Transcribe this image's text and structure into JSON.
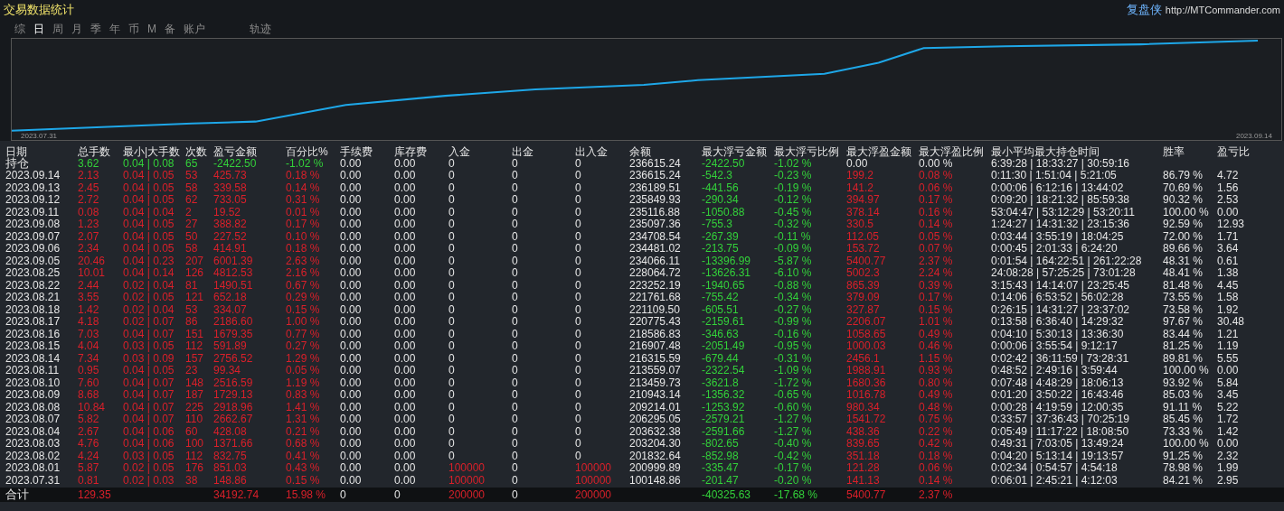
{
  "title": "交易数据统计",
  "brand": {
    "name": "复盘侠",
    "url": "http://MTCommander.com"
  },
  "tabs": [
    {
      "label": "综",
      "selected": false
    },
    {
      "label": "日",
      "selected": true
    },
    {
      "label": "周",
      "selected": false
    },
    {
      "label": "月",
      "selected": false
    },
    {
      "label": "季",
      "selected": false
    },
    {
      "label": "年",
      "selected": false
    },
    {
      "label": "币",
      "selected": false
    },
    {
      "label": "M",
      "selected": false
    },
    {
      "label": "备",
      "selected": false
    },
    {
      "label": "账户",
      "selected": false
    },
    {
      "label": "轨迹",
      "selected": false
    }
  ],
  "chart": {
    "start_label": "2023.07.31",
    "end_label": "2023.09.14"
  },
  "table": {
    "columns": [
      "日期",
      "总手数",
      "最小|大手数",
      "次数",
      "盈亏金额",
      "百分比%",
      "手续费",
      "库存费",
      "入金",
      "出金",
      "出入金",
      "余额",
      "最大浮亏金额",
      "最大浮亏比例",
      "最大浮盈金额",
      "最大浮盈比例",
      "最小平均最大持仓时间",
      "胜率",
      "盈亏比"
    ],
    "rows": [
      {
        "kind": "open",
        "deposit": false,
        "cells": [
          "持仓",
          "3.62",
          "0.04 | 0.08",
          "65",
          "-2422.50",
          "-1.02 %",
          "0.00",
          "0.00",
          "0",
          "0",
          "0",
          "236615.24",
          "-2422.50",
          "-1.02 %",
          "0.00",
          "0.00 %",
          "6:39:28 | 18:33:27 | 30:59:16",
          null,
          null
        ]
      },
      {
        "kind": "day",
        "deposit": false,
        "cells": [
          "2023.09.14",
          "2.13",
          "0.04 | 0.05",
          "53",
          "425.73",
          "0.18 %",
          "0.00",
          "0.00",
          "0",
          "0",
          "0",
          "236615.24",
          "-542.3",
          "-0.23 %",
          "199.2",
          "0.08 %",
          "0:11:30 | 1:51:04 | 5:21:05",
          "86.79 %",
          "4.72"
        ]
      },
      {
        "kind": "day",
        "deposit": false,
        "cells": [
          "2023.09.13",
          "2.45",
          "0.04 | 0.05",
          "58",
          "339.58",
          "0.14 %",
          "0.00",
          "0.00",
          "0",
          "0",
          "0",
          "236189.51",
          "-441.56",
          "-0.19 %",
          "141.2",
          "0.06 %",
          "0:00:06 | 6:12:16 | 13:44:02",
          "70.69 %",
          "1.56"
        ]
      },
      {
        "kind": "day",
        "deposit": false,
        "cells": [
          "2023.09.12",
          "2.72",
          "0.04 | 0.05",
          "62",
          "733.05",
          "0.31 %",
          "0.00",
          "0.00",
          "0",
          "0",
          "0",
          "235849.93",
          "-290.34",
          "-0.12 %",
          "394.97",
          "0.17 %",
          "0:09:20 | 18:21:32 | 85:59:38",
          "90.32 %",
          "2.53"
        ]
      },
      {
        "kind": "day",
        "deposit": false,
        "cells": [
          "2023.09.11",
          "0.08",
          "0.04 | 0.04",
          "2",
          "19.52",
          "0.01 %",
          "0.00",
          "0.00",
          "0",
          "0",
          "0",
          "235116.88",
          "-1050.88",
          "-0.45 %",
          "378.14",
          "0.16 %",
          "53:04:47 | 53:12:29 | 53:20:11",
          "100.00 %",
          "0.00"
        ]
      },
      {
        "kind": "day",
        "deposit": false,
        "cells": [
          "2023.09.08",
          "1.23",
          "0.04 | 0.05",
          "27",
          "388.82",
          "0.17 %",
          "0.00",
          "0.00",
          "0",
          "0",
          "0",
          "235097.36",
          "-755.3",
          "-0.32 %",
          "330.5",
          "0.14 %",
          "1:24:27 | 14:31:32 | 23:15:36",
          "92.59 %",
          "12.93"
        ]
      },
      {
        "kind": "day",
        "deposit": false,
        "cells": [
          "2023.09.07",
          "2.07",
          "0.04 | 0.05",
          "50",
          "227.52",
          "0.10 %",
          "0.00",
          "0.00",
          "0",
          "0",
          "0",
          "234708.54",
          "-267.39",
          "-0.11 %",
          "112.05",
          "0.05 %",
          "0:03:44 | 3:55:19 | 18:04:25",
          "72.00 %",
          "1.71"
        ]
      },
      {
        "kind": "day",
        "deposit": false,
        "cells": [
          "2023.09.06",
          "2.34",
          "0.04 | 0.05",
          "58",
          "414.91",
          "0.18 %",
          "0.00",
          "0.00",
          "0",
          "0",
          "0",
          "234481.02",
          "-213.75",
          "-0.09 %",
          "153.72",
          "0.07 %",
          "0:00:45 | 2:01:33 | 6:24:20",
          "89.66 %",
          "3.64"
        ]
      },
      {
        "kind": "day",
        "deposit": false,
        "cells": [
          "2023.09.05",
          "20.46",
          "0.04 | 0.23",
          "207",
          "6001.39",
          "2.63 %",
          "0.00",
          "0.00",
          "0",
          "0",
          "0",
          "234066.11",
          "-13396.99",
          "-5.87 %",
          "5400.77",
          "2.37 %",
          "0:01:54 | 164:22:51 | 261:22:28",
          "48.31 %",
          "0.61"
        ]
      },
      {
        "kind": "day",
        "deposit": false,
        "cells": [
          "2023.08.25",
          "10.01",
          "0.04 | 0.14",
          "126",
          "4812.53",
          "2.16 %",
          "0.00",
          "0.00",
          "0",
          "0",
          "0",
          "228064.72",
          "-13626.31",
          "-6.10 %",
          "5002.3",
          "2.24 %",
          "24:08:28 | 57:25:25 | 73:01:28",
          "48.41 %",
          "1.38"
        ]
      },
      {
        "kind": "day",
        "deposit": false,
        "cells": [
          "2023.08.22",
          "2.44",
          "0.02 | 0.04",
          "81",
          "1490.51",
          "0.67 %",
          "0.00",
          "0.00",
          "0",
          "0",
          "0",
          "223252.19",
          "-1940.65",
          "-0.88 %",
          "865.39",
          "0.39 %",
          "3:15:43 | 14:14:07 | 23:25:45",
          "81.48 %",
          "4.45"
        ]
      },
      {
        "kind": "day",
        "deposit": false,
        "cells": [
          "2023.08.21",
          "3.55",
          "0.02 | 0.05",
          "121",
          "652.18",
          "0.29 %",
          "0.00",
          "0.00",
          "0",
          "0",
          "0",
          "221761.68",
          "-755.42",
          "-0.34 %",
          "379.09",
          "0.17 %",
          "0:14:06 | 6:53:52 | 56:02:28",
          "73.55 %",
          "1.58"
        ]
      },
      {
        "kind": "day",
        "deposit": false,
        "cells": [
          "2023.08.18",
          "1.42",
          "0.02 | 0.04",
          "53",
          "334.07",
          "0.15 %",
          "0.00",
          "0.00",
          "0",
          "0",
          "0",
          "221109.50",
          "-605.51",
          "-0.27 %",
          "327.87",
          "0.15 %",
          "0:26:15 | 14:31:27 | 23:37:02",
          "73.58 %",
          "1.92"
        ]
      },
      {
        "kind": "day",
        "deposit": false,
        "cells": [
          "2023.08.17",
          "4.18",
          "0.02 | 0.07",
          "86",
          "2186.60",
          "1.00 %",
          "0.00",
          "0.00",
          "0",
          "0",
          "0",
          "220775.43",
          "-2159.61",
          "-0.99 %",
          "2206.07",
          "1.01 %",
          "0:13:58 | 6:36:40 | 14:29:32",
          "97.67 %",
          "30.48"
        ]
      },
      {
        "kind": "day",
        "deposit": false,
        "cells": [
          "2023.08.16",
          "7.03",
          "0.04 | 0.07",
          "151",
          "1679.35",
          "0.77 %",
          "0.00",
          "0.00",
          "0",
          "0",
          "0",
          "218586.83",
          "-346.63",
          "-0.16 %",
          "1058.65",
          "0.49 %",
          "0:04:10 | 5:30:13 | 13:36:30",
          "83.44 %",
          "1.21"
        ]
      },
      {
        "kind": "day",
        "deposit": false,
        "cells": [
          "2023.08.15",
          "4.04",
          "0.03 | 0.05",
          "112",
          "591.89",
          "0.27 %",
          "0.00",
          "0.00",
          "0",
          "0",
          "0",
          "216907.48",
          "-2051.49",
          "-0.95 %",
          "1000.03",
          "0.46 %",
          "0:00:06 | 3:55:54 | 9:12:17",
          "81.25 %",
          "1.19"
        ]
      },
      {
        "kind": "day",
        "deposit": false,
        "cells": [
          "2023.08.14",
          "7.34",
          "0.03 | 0.09",
          "157",
          "2756.52",
          "1.29 %",
          "0.00",
          "0.00",
          "0",
          "0",
          "0",
          "216315.59",
          "-679.44",
          "-0.31 %",
          "2456.1",
          "1.15 %",
          "0:02:42 | 36:11:59 | 73:28:31",
          "89.81 %",
          "5.55"
        ]
      },
      {
        "kind": "day",
        "deposit": false,
        "cells": [
          "2023.08.11",
          "0.95",
          "0.04 | 0.05",
          "23",
          "99.34",
          "0.05 %",
          "0.00",
          "0.00",
          "0",
          "0",
          "0",
          "213559.07",
          "-2322.54",
          "-1.09 %",
          "1988.91",
          "0.93 %",
          "0:48:52 | 2:49:16 | 3:59:44",
          "100.00 %",
          "0.00"
        ]
      },
      {
        "kind": "day",
        "deposit": false,
        "cells": [
          "2023.08.10",
          "7.60",
          "0.04 | 0.07",
          "148",
          "2516.59",
          "1.19 %",
          "0.00",
          "0.00",
          "0",
          "0",
          "0",
          "213459.73",
          "-3621.8",
          "-1.72 %",
          "1680.36",
          "0.80 %",
          "0:07:48 | 4:48:29 | 18:06:13",
          "93.92 %",
          "5.84"
        ]
      },
      {
        "kind": "day",
        "deposit": false,
        "cells": [
          "2023.08.09",
          "8.68",
          "0.04 | 0.07",
          "187",
          "1729.13",
          "0.83 %",
          "0.00",
          "0.00",
          "0",
          "0",
          "0",
          "210943.14",
          "-1356.32",
          "-0.65 %",
          "1016.78",
          "0.49 %",
          "0:01:20 | 3:50:22 | 16:43:46",
          "85.03 %",
          "3.45"
        ]
      },
      {
        "kind": "day",
        "deposit": false,
        "cells": [
          "2023.08.08",
          "10.84",
          "0.04 | 0.07",
          "225",
          "2918.96",
          "1.41 %",
          "0.00",
          "0.00",
          "0",
          "0",
          "0",
          "209214.01",
          "-1253.92",
          "-0.60 %",
          "980.34",
          "0.48 %",
          "0:00:28 | 4:19:59 | 12:00:35",
          "91.11 %",
          "5.22"
        ]
      },
      {
        "kind": "day",
        "deposit": false,
        "cells": [
          "2023.08.07",
          "5.82",
          "0.04 | 0.07",
          "110",
          "2662.67",
          "1.31 %",
          "0.00",
          "0.00",
          "0",
          "0",
          "0",
          "206295.05",
          "-2579.21",
          "-1.27 %",
          "1541.72",
          "0.75 %",
          "0:33:57 | 37:36:43 | 70:25:19",
          "85.45 %",
          "1.72"
        ]
      },
      {
        "kind": "day",
        "deposit": false,
        "cells": [
          "2023.08.04",
          "2.67",
          "0.04 | 0.06",
          "60",
          "428.08",
          "0.21 %",
          "0.00",
          "0.00",
          "0",
          "0",
          "0",
          "203632.38",
          "-2591.66",
          "-1.27 %",
          "438.36",
          "0.22 %",
          "0:05:49 | 11:17:22 | 18:08:50",
          "73.33 %",
          "1.42"
        ]
      },
      {
        "kind": "day",
        "deposit": false,
        "cells": [
          "2023.08.03",
          "4.76",
          "0.04 | 0.06",
          "100",
          "1371.66",
          "0.68 %",
          "0.00",
          "0.00",
          "0",
          "0",
          "0",
          "203204.30",
          "-802.65",
          "-0.40 %",
          "839.65",
          "0.42 %",
          "0:49:31 | 7:03:05 | 13:49:24",
          "100.00 %",
          "0.00"
        ]
      },
      {
        "kind": "day",
        "deposit": false,
        "cells": [
          "2023.08.02",
          "4.24",
          "0.03 | 0.05",
          "112",
          "832.75",
          "0.41 %",
          "0.00",
          "0.00",
          "0",
          "0",
          "0",
          "201832.64",
          "-852.98",
          "-0.42 %",
          "351.18",
          "0.18 %",
          "0:04:20 | 5:13:14 | 19:13:57",
          "91.25 %",
          "2.32"
        ]
      },
      {
        "kind": "day",
        "deposit": true,
        "cells": [
          "2023.08.01",
          "5.87",
          "0.02 | 0.05",
          "176",
          "851.03",
          "0.43 %",
          "0.00",
          "0.00",
          "100000",
          "0",
          "100000",
          "200999.89",
          "-335.47",
          "-0.17 %",
          "121.28",
          "0.06 %",
          "0:02:34 | 0:54:57 | 4:54:18",
          "78.98 %",
          "1.99"
        ]
      },
      {
        "kind": "day",
        "deposit": true,
        "cells": [
          "2023.07.31",
          "0.81",
          "0.02 | 0.03",
          "38",
          "148.86",
          "0.15 %",
          "0.00",
          "0.00",
          "100000",
          "0",
          "100000",
          "100148.86",
          "-201.47",
          "-0.20 %",
          "141.13",
          "0.14 %",
          "0:06:01 | 2:45:21 | 4:12:03",
          "84.21 %",
          "2.95"
        ]
      },
      {
        "kind": "total",
        "deposit": true,
        "cells": [
          "合计",
          "129.35",
          null,
          null,
          "34192.74",
          "15.98 %",
          "0",
          "0",
          "200000",
          "0",
          "200000",
          null,
          "-40325.63",
          "-17.68 %",
          "5400.77",
          "2.37 %",
          null,
          null,
          null
        ]
      }
    ]
  }
}
